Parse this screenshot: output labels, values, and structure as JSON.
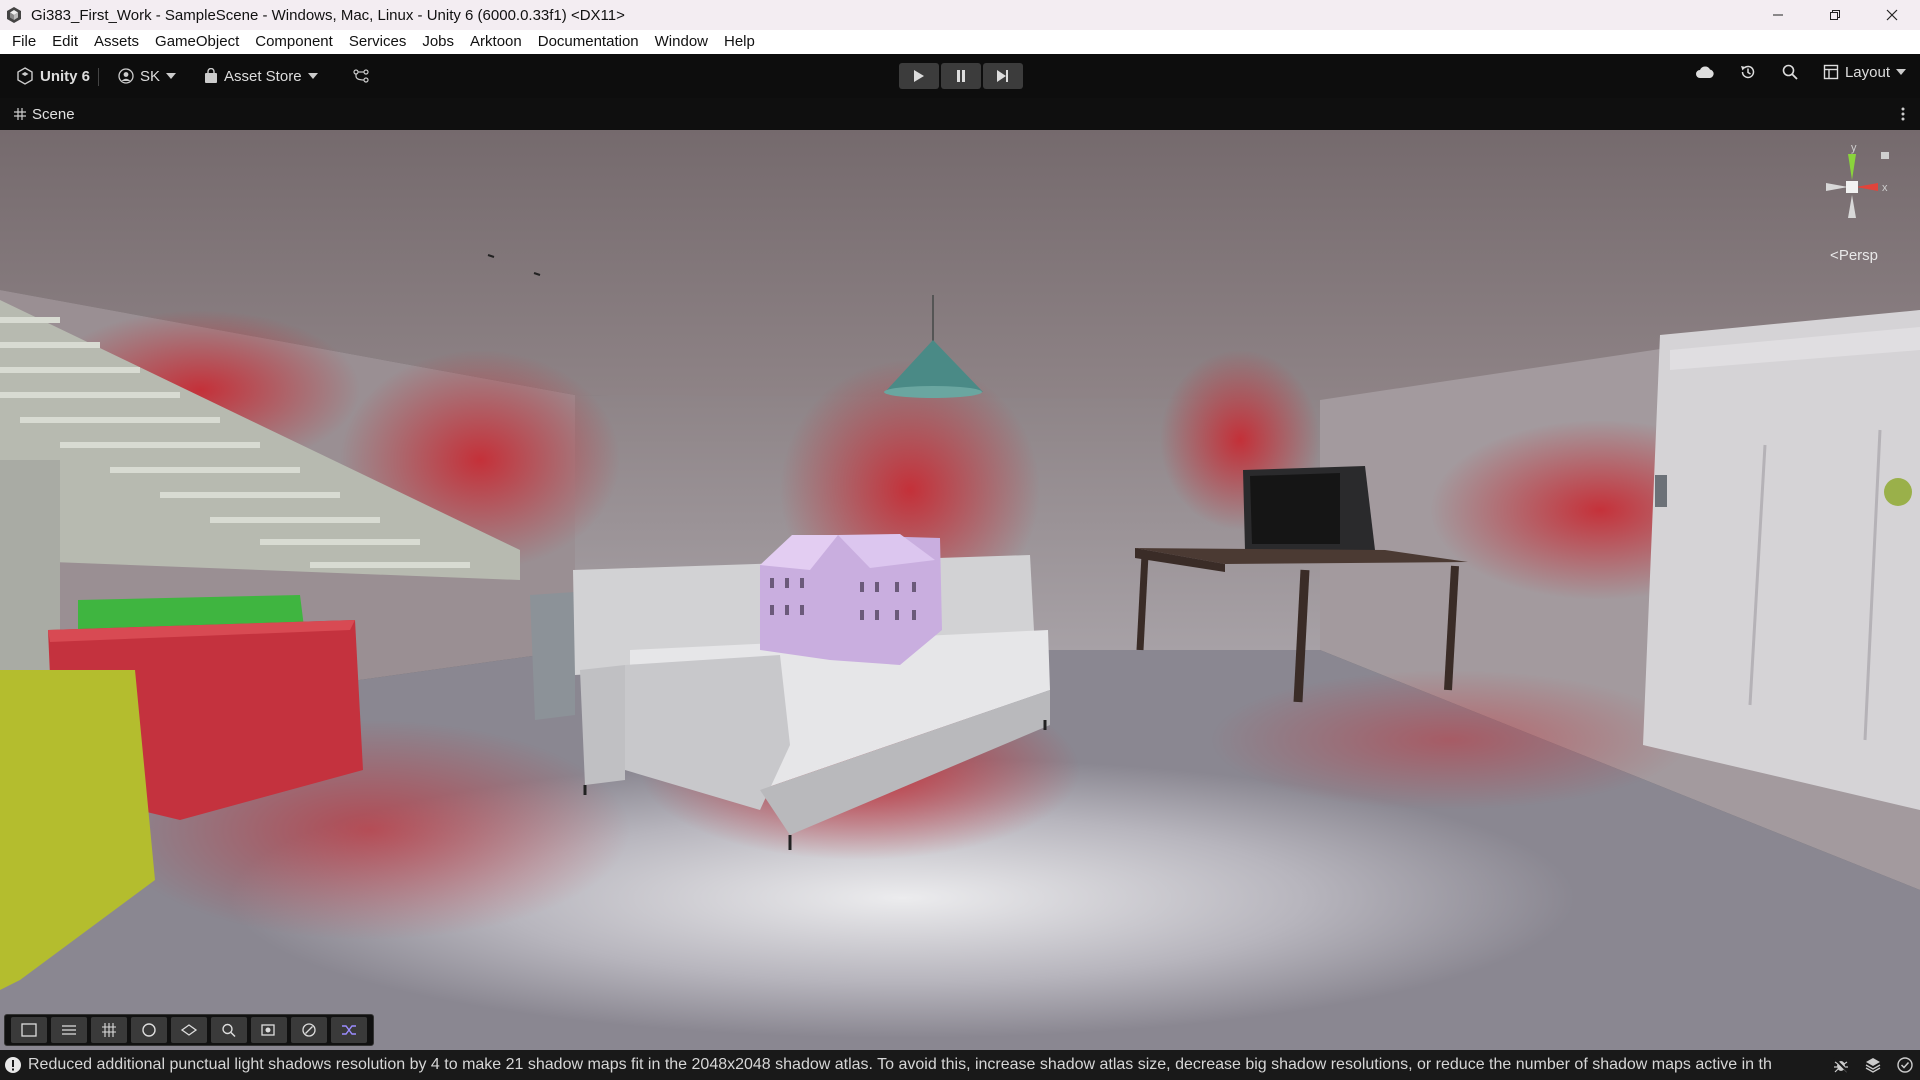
{
  "window": {
    "title": "Gi383_First_Work - SampleScene - Windows, Mac, Linux - Unity 6 (6000.0.33f1) <DX11>",
    "controls": [
      "minimize",
      "restore",
      "close"
    ]
  },
  "menu": {
    "items": [
      "File",
      "Edit",
      "Assets",
      "GameObject",
      "Component",
      "Services",
      "Jobs",
      "Arktoon",
      "Documentation",
      "Window",
      "Help"
    ]
  },
  "toolbar": {
    "unity_label": "Unity 6",
    "account_label": "SK",
    "asset_store_label": "Asset Store",
    "layout_label": "Layout"
  },
  "scene_tab": {
    "label": "Scene"
  },
  "viewport": {
    "projection_label": "Persp",
    "gizmo_y_label": "y",
    "gizmo_x_label": "x"
  },
  "overlay_tools": [
    "rect-select-icon",
    "transform-icon",
    "grid-icon",
    "shading-icon",
    "gizmo-icon",
    "search-icon",
    "camera-icon",
    "compass-icon",
    "shuffle-icon"
  ],
  "status": {
    "message": "Reduced additional punctual light shadows resolution by 4 to make 21 shadow maps fit in the 2048x2048 shadow atlas. To avoid this, increase shadow atlas size, decrease big shadow resolutions, or reduce the number of shadow maps active in th"
  },
  "colors": {
    "toolbar_bg": "#0d0d0d",
    "title_bg": "#f3edf2",
    "gizmo_x": "#e0443b",
    "gizmo_y": "#8ad43c"
  }
}
